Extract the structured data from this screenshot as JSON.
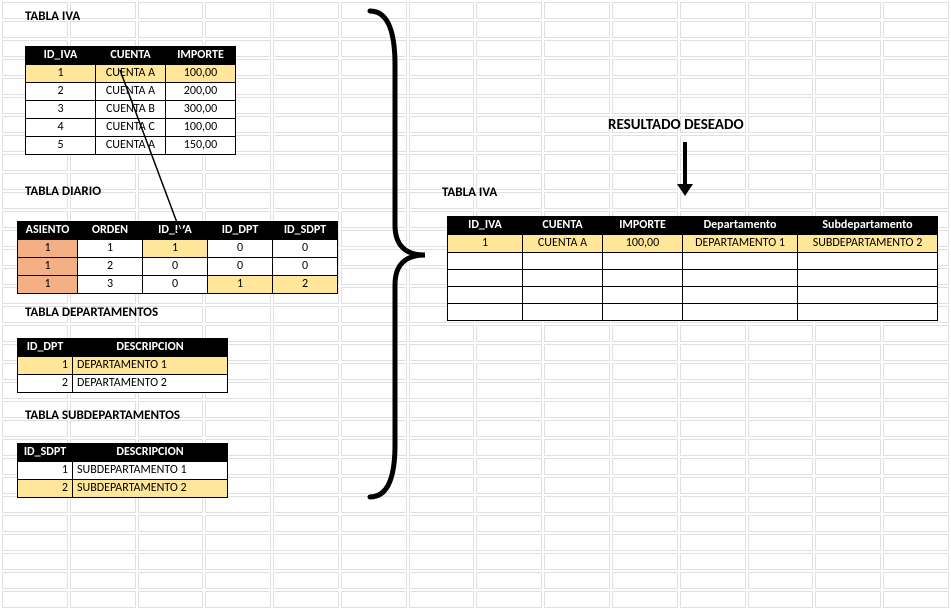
{
  "sections": {
    "tabla_iva": "TABLA IVA",
    "tabla_diario": "TABLA DIARIO",
    "tabla_departamentos": "TABLA DEPARTAMENTOS",
    "tabla_subdepartamentos": "TABLA SUBDEPARTAMENTOS",
    "resultado_deseado": "RESULTADO DESEADO",
    "tabla_iva_right": "TABLA IVA"
  },
  "iva": {
    "headers": [
      "ID_IVA",
      "CUENTA",
      "IMPORTE"
    ],
    "rows": [
      {
        "id": "1",
        "cuenta": "CUENTA A",
        "importe": "100,00",
        "hl": true
      },
      {
        "id": "2",
        "cuenta": "CUENTA A",
        "importe": "200,00"
      },
      {
        "id": "3",
        "cuenta": "CUENTA B",
        "importe": "300,00"
      },
      {
        "id": "4",
        "cuenta": "CUENTA C",
        "importe": "100,00"
      },
      {
        "id": "5",
        "cuenta": "CUENTA A",
        "importe": "150,00"
      }
    ]
  },
  "diario": {
    "headers": [
      "ASIENTO",
      "ORDEN",
      "ID_IVA",
      "ID_DPT",
      "ID_SDPT"
    ],
    "rows": [
      {
        "asiento": "1",
        "orden": "1",
        "idiva": "1",
        "iddpt": "0",
        "idsdpt": "0",
        "hl_iva": true
      },
      {
        "asiento": "1",
        "orden": "2",
        "idiva": "0",
        "iddpt": "0",
        "idsdpt": "0"
      },
      {
        "asiento": "1",
        "orden": "3",
        "idiva": "0",
        "iddpt": "1",
        "idsdpt": "2",
        "hl_dpt": true
      }
    ]
  },
  "departamentos": {
    "headers": [
      "ID_DPT",
      "DESCRIPCION"
    ],
    "rows": [
      {
        "id": "1",
        "desc": "DEPARTAMENTO 1",
        "hl": true
      },
      {
        "id": "2",
        "desc": "DEPARTAMENTO 2"
      }
    ]
  },
  "subdepartamentos": {
    "headers": [
      "ID_SDPT",
      "DESCRIPCION"
    ],
    "rows": [
      {
        "id": "1",
        "desc": "SUBDEPARTAMENTO 1"
      },
      {
        "id": "2",
        "desc": "SUBDEPARTAMENTO 2",
        "hl": true
      }
    ]
  },
  "resultado": {
    "headers": [
      "ID_IVA",
      "CUENTA",
      "IMPORTE",
      "Departamento",
      "Subdepartamento"
    ],
    "row": {
      "idiva": "1",
      "cuenta": "CUENTA A",
      "importe": "100,00",
      "dpt": "DEPARTAMENTO 1",
      "sdpt": "SUBDEPARTAMENTO 2"
    }
  }
}
